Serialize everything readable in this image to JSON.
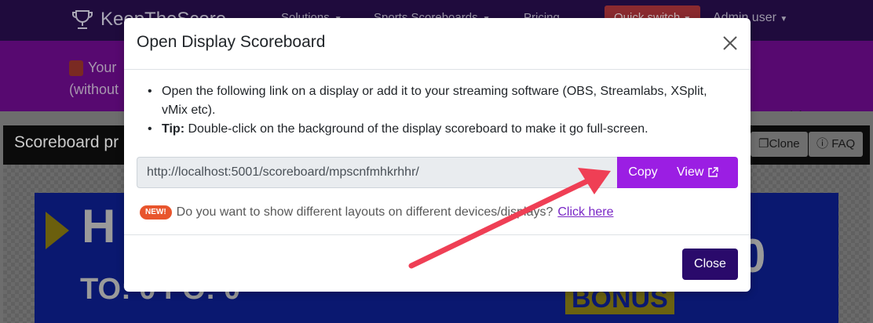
{
  "navbar": {
    "brand": "KeepTheScore",
    "links": [
      "Solutions",
      "Sports Scoreboards",
      "Pricing"
    ],
    "quick_switch": "Quick switch",
    "user": "Admin user"
  },
  "promo": {
    "line1": "Your",
    "line2": "(without"
  },
  "card": {
    "title": "Scoreboard pr",
    "clone_label": "Clone",
    "faq_label": "FAQ"
  },
  "board": {
    "team_partial": "H",
    "score_partial": "0",
    "to_fo": "TO: 0  FO: 0",
    "bonus": "BONUS"
  },
  "modal": {
    "title": "Open Display Scoreboard",
    "bullet1": "Open the following link on a display or add it to your streaming software (OBS, Streamlabs, XSplit, vMix etc).",
    "tip_label": "Tip:",
    "tip_text": " Double-click on the background of the display scoreboard to make it go full-screen.",
    "link_url": "http://localhost:5001/scoreboard/mpscnfmhkrhhr/",
    "copy_label": "Copy",
    "view_label": "View",
    "new_badge": "NEW!",
    "new_text": "Do you want to show different layouts on different devices/displays?",
    "click_here": "Click here",
    "close_label": "Close"
  },
  "colors": {
    "accent": "#9b1ee3",
    "close_button": "#2a0a6b",
    "new_badge": "#e8552d",
    "arrow": "#ef3f55"
  }
}
